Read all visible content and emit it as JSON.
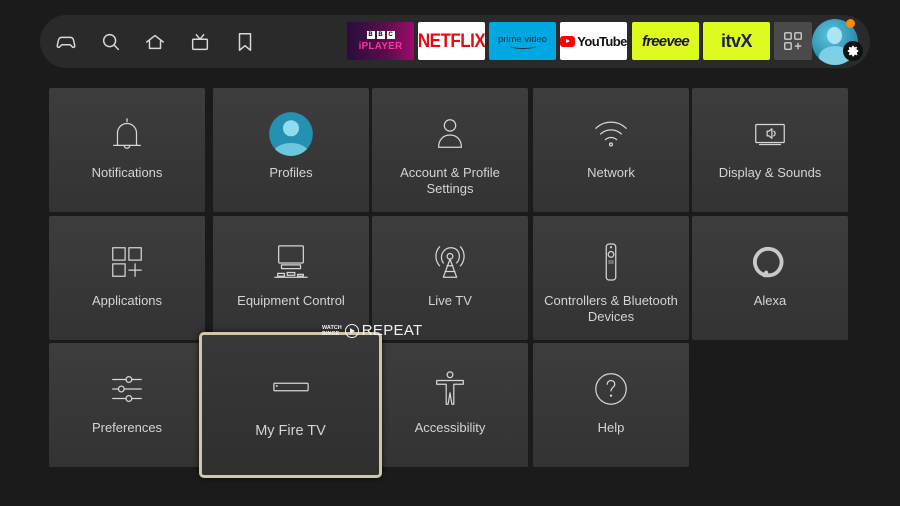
{
  "nav": {
    "icons": [
      {
        "name": "gamepad-icon",
        "label": "Games"
      },
      {
        "name": "search-icon",
        "label": "Search"
      },
      {
        "name": "home-icon",
        "label": "Home"
      },
      {
        "name": "live-tv-icon",
        "label": "Live"
      },
      {
        "name": "bookmark-icon",
        "label": "My Stuff"
      }
    ],
    "apps": {
      "bbc": {
        "blocks": [
          "B",
          "B",
          "C"
        ],
        "label": "iPLAYER"
      },
      "netflix": {
        "label": "NETFLIX"
      },
      "prime": {
        "label": "prime video"
      },
      "youtube": {
        "label": "YouTube"
      },
      "freevee": {
        "label": "freevee"
      },
      "itvx": {
        "label": "itvX"
      }
    },
    "app_colors": {
      "netflix": "#e50914",
      "prime": "#00a8e1",
      "freevee": "#ddfb1e",
      "itvx": "#ddfb1e"
    },
    "profile": {
      "has_notification": true,
      "notification_color": "#ff8a00"
    }
  },
  "settings": {
    "tiles": [
      {
        "id": "notifications",
        "label": "Notifications",
        "icon": "bell-icon"
      },
      {
        "id": "profiles",
        "label": "Profiles",
        "icon": "profile-avatar-icon"
      },
      {
        "id": "account",
        "label": "Account & Profile Settings",
        "icon": "person-icon"
      },
      {
        "id": "network",
        "label": "Network",
        "icon": "wifi-icon"
      },
      {
        "id": "display",
        "label": "Display & Sounds",
        "icon": "display-sound-icon"
      },
      {
        "id": "applications",
        "label": "Applications",
        "icon": "apps-grid-icon"
      },
      {
        "id": "equipment",
        "label": "Equipment Control",
        "icon": "equipment-icon"
      },
      {
        "id": "livetv",
        "label": "Live TV",
        "icon": "antenna-icon"
      },
      {
        "id": "controllers",
        "label": "Controllers & Bluetooth Devices",
        "icon": "remote-icon"
      },
      {
        "id": "alexa",
        "label": "Alexa",
        "icon": "alexa-icon"
      },
      {
        "id": "preferences",
        "label": "Preferences",
        "icon": "sliders-icon"
      },
      {
        "id": "myfiretv",
        "label": "My Fire TV",
        "icon": "fire-tv-device-icon"
      },
      {
        "id": "accessibility",
        "label": "Accessibility",
        "icon": "accessibility-icon"
      },
      {
        "id": "help",
        "label": "Help",
        "icon": "help-icon"
      }
    ],
    "focused": "myfiretv"
  },
  "watermark": {
    "small_top": "WATCH",
    "small_bottom": "BINGE",
    "big": "REPEAT"
  }
}
